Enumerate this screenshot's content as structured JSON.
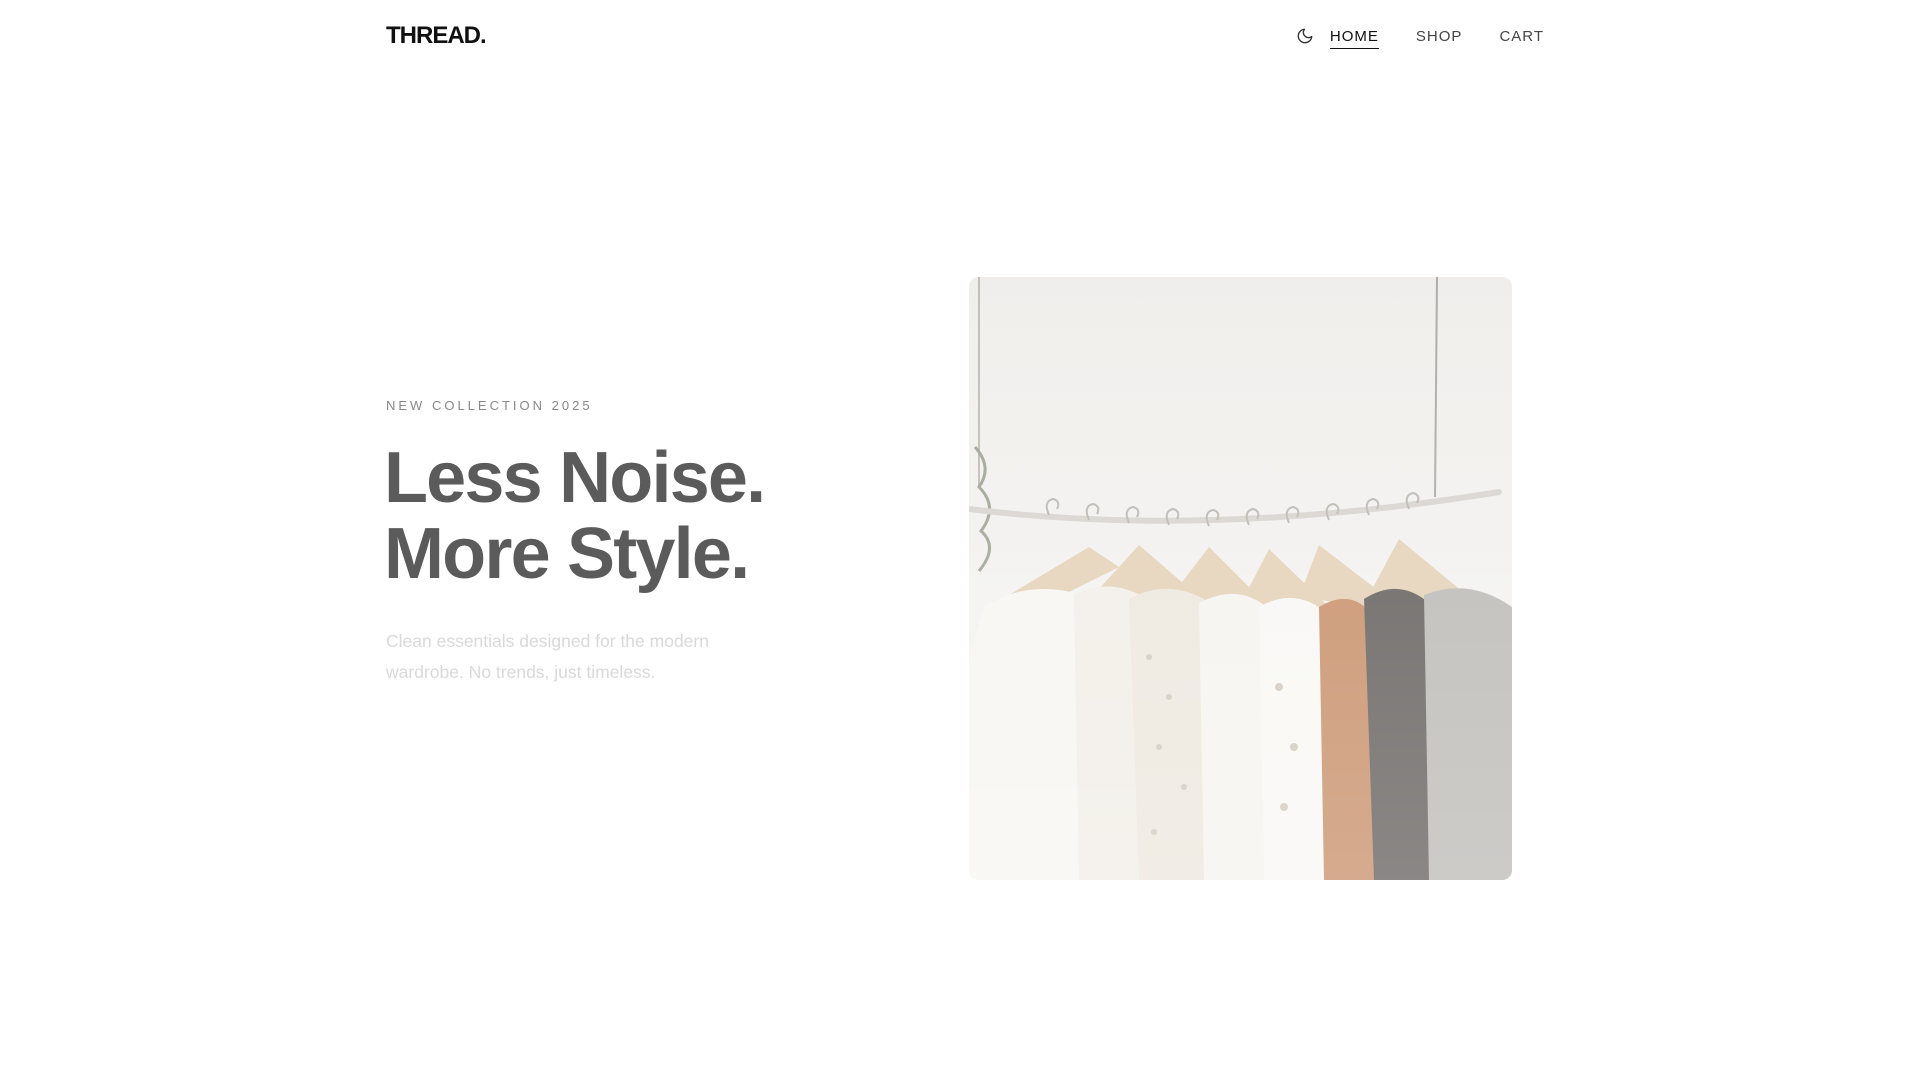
{
  "brand": {
    "logo": "THREAD."
  },
  "nav": {
    "theme_icon": "moon-icon",
    "items": [
      {
        "label": "HOME",
        "active": true
      },
      {
        "label": "SHOP",
        "active": false
      },
      {
        "label": "CART",
        "active": false
      }
    ]
  },
  "hero": {
    "eyebrow": "NEW COLLECTION 2025",
    "headline_line1": "Less Noise.",
    "headline_line2": "More Style.",
    "subtext": "Clean essentials designed for the modern wardrobe. No trends, just timeless.",
    "image_subject": "clothes-rack-photo"
  },
  "colors": {
    "background": "#ffffff",
    "text_primary": "#111111",
    "headline": "#5b5b5b",
    "muted": "#888888",
    "subtext": "#d9d9d9"
  }
}
